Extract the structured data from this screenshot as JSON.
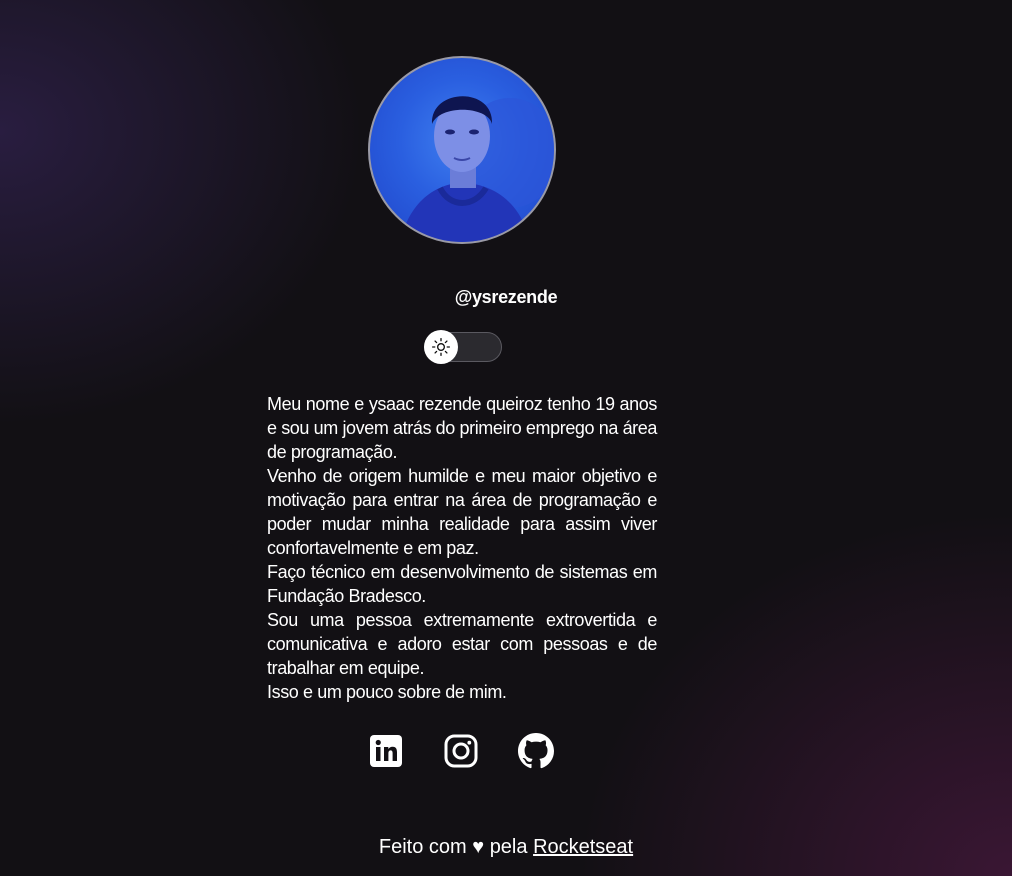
{
  "profile": {
    "avatar_icon": "profile-photo",
    "username": "@ysrezende"
  },
  "theme_switch": {
    "icon": "sun-icon",
    "state": "light"
  },
  "bio": {
    "paragraphs": [
      "Meu nome e ysaac rezende queiroz tenho 19 anos e sou um jovem atrás do primeiro emprego na área de programação.",
      "Venho de origem humilde e meu maior objetivo e motivação para entrar na área de programação e poder mudar minha realidade para assim viver confortavelmente e em paz.",
      "Faço técnico em desenvolvimento de sistemas em Fundação Bradesco.",
      "Sou uma pessoa extremamente extrovertida e comunicativa e adoro estar com pessoas e de trabalhar em equipe.",
      "Isso e um pouco sobre de mim."
    ]
  },
  "socials": [
    {
      "icon": "linkedin-icon"
    },
    {
      "icon": "instagram-icon"
    },
    {
      "icon": "github-icon"
    }
  ],
  "footer": {
    "text_before": "Feito com",
    "heart": "♥",
    "text_middle": "pela",
    "link_label": "Rocketseat"
  },
  "colors": {
    "background": "#121014",
    "text": "#ffffff",
    "avatar_blue": "#2a5fe0"
  }
}
